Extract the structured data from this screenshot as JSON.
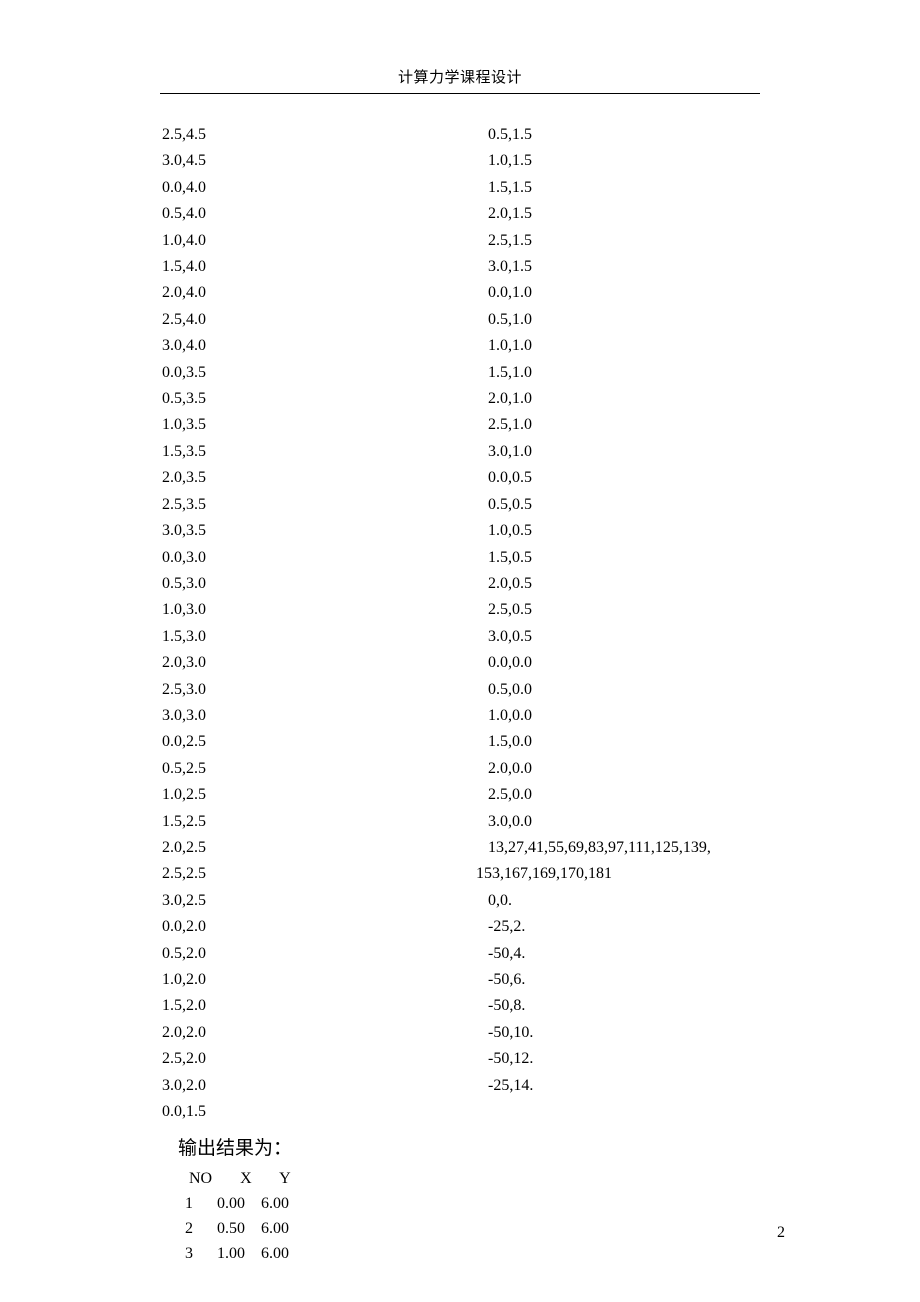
{
  "header_title": "计算力学课程设计",
  "page_number": "2",
  "left_column": [
    "2.5,4.5",
    "3.0,4.5",
    "0.0,4.0",
    "0.5,4.0",
    "1.0,4.0",
    "1.5,4.0",
    "2.0,4.0",
    "2.5,4.0",
    "3.0,4.0",
    "0.0,3.5",
    "0.5,3.5",
    "1.0,3.5",
    "1.5,3.5",
    "2.0,3.5",
    "2.5,3.5",
    "3.0,3.5",
    "0.0,3.0",
    "0.5,3.0",
    "1.0,3.0",
    "1.5,3.0",
    "2.0,3.0",
    "2.5,3.0",
    "3.0,3.0",
    "0.0,2.5",
    "0.5,2.5",
    "1.0,2.5",
    "1.5,2.5",
    "2.0,2.5",
    "2.5,2.5",
    "3.0,2.5",
    "0.0,2.0",
    "0.5,2.0",
    "1.0,2.0",
    "1.5,2.0",
    "2.0,2.0",
    "2.5,2.0",
    "3.0,2.0",
    "0.0,1.5"
  ],
  "right_column_coords": [
    "0.5,1.5",
    "1.0,1.5",
    "1.5,1.5",
    "2.0,1.5",
    "2.5,1.5",
    "3.0,1.5",
    "0.0,1.0",
    "0.5,1.0",
    "1.0,1.0",
    "1.5,1.0",
    "2.0,1.0",
    "2.5,1.0",
    "3.0,1.0",
    "0.0,0.5",
    "0.5,0.5",
    "1.0,0.5",
    "1.5,0.5",
    "2.0,0.5",
    "2.5,0.5",
    "3.0,0.5",
    "0.0,0.0",
    "0.5,0.0",
    "1.0,0.0",
    "1.5,0.0",
    "2.0,0.0",
    "2.5,0.0",
    "3.0,0.0"
  ],
  "right_column_idx_line1": "13,27,41,55,69,83,97,111,125,139,",
  "right_column_idx_line2": "153,167,169,170,181",
  "right_column_tail": [
    "0,0.",
    "-25,2.",
    "-50,4.",
    "-50,6.",
    "-50,8.",
    "-50,10.",
    "-50,12.",
    "-25,14."
  ],
  "output_heading": "输出结果为：",
  "output_table": {
    "header": [
      "NO",
      "X",
      "Y"
    ],
    "rows": [
      [
        "1",
        "0.00",
        "6.00"
      ],
      [
        "2",
        "0.50",
        "6.00"
      ],
      [
        "3",
        "1.00",
        "6.00"
      ]
    ]
  }
}
